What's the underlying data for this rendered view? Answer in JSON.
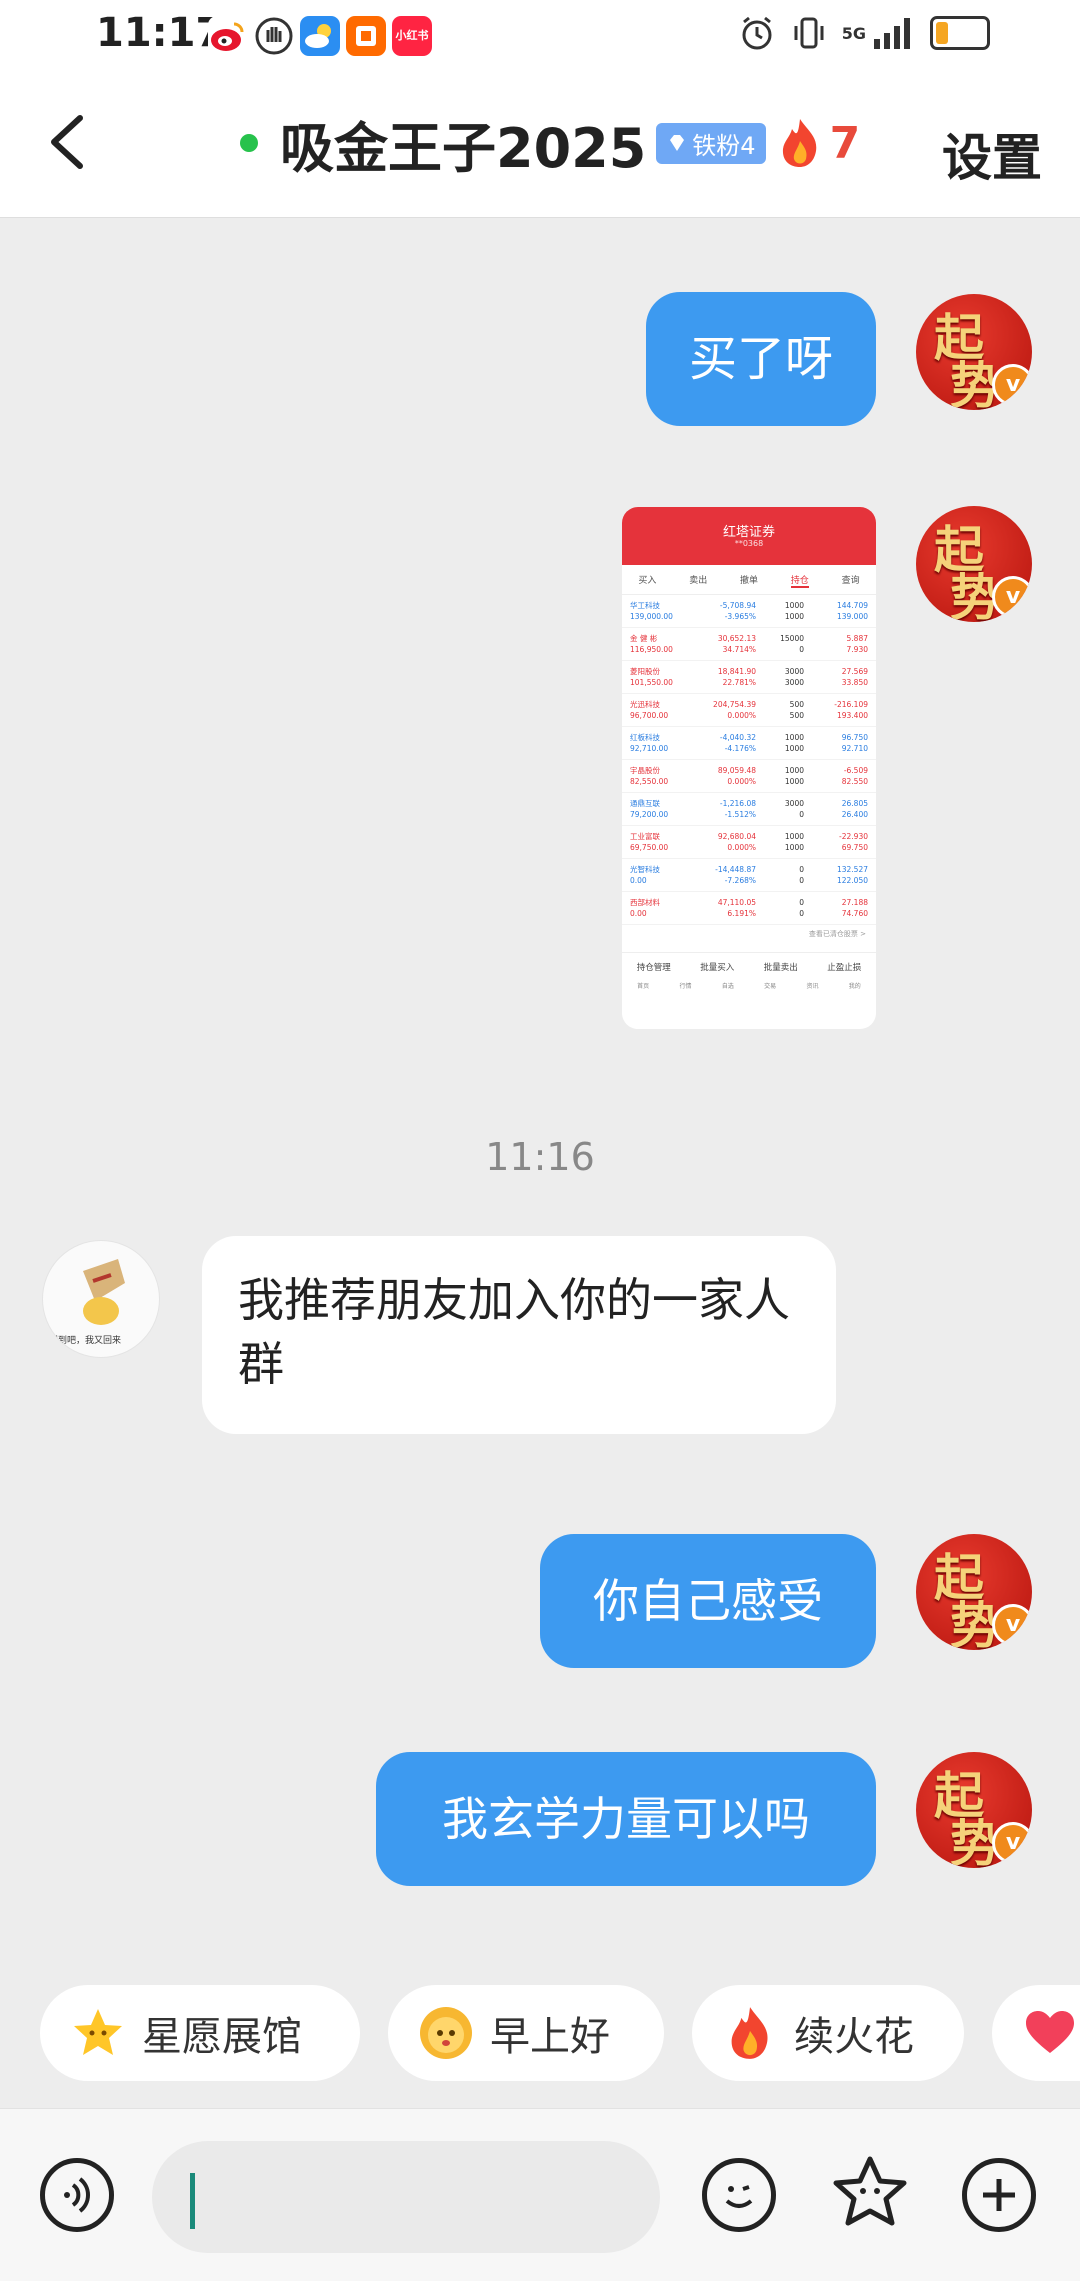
{
  "status_bar": {
    "time": "11:17",
    "app_icons": [
      "weibo-icon",
      "hand-icon",
      "weather-icon",
      "taobao-icon",
      "xiaohongshu-icon"
    ],
    "xiaohongshu_label": "小红书",
    "network": "5G",
    "battery_level": 0.25
  },
  "header": {
    "title": "吸金王子2025",
    "fan_badge": "铁粉4",
    "flame_count": "7",
    "settings_label": "设置",
    "online_color": "#27c24c"
  },
  "messages": [
    {
      "from": "me",
      "text": "买了呀"
    },
    {
      "from": "me",
      "type": "image"
    },
    {
      "from": "other",
      "text": "我推荐朋友加入你的一家人群"
    },
    {
      "from": "me",
      "text": "你自己感受"
    },
    {
      "from": "me",
      "text": "我玄学力量可以吗"
    }
  ],
  "avatar_me": {
    "chars": [
      "起",
      "势"
    ],
    "badge": "v"
  },
  "avatar_other": {
    "caption": "想到吧，我又回来"
  },
  "timestamp": "11:16",
  "shared_screenshot": {
    "app_title": "红塔证券",
    "account": "**0368",
    "tabs": [
      "买入",
      "卖出",
      "撤单",
      "持仓",
      "查询"
    ],
    "active_tab": "持仓",
    "rows": [
      {
        "name": "华工科技",
        "cost": "139,000.00",
        "pnl": "-5,708.94",
        "pct": "-3.965%",
        "qty": "1000",
        "avail": "1000",
        "price": "144.709",
        "cur": "139.000",
        "dir": "down"
      },
      {
        "name": "金 健 彬",
        "cost": "116,950.00",
        "pnl": "30,652.13",
        "pct": "34.714%",
        "qty": "15000",
        "avail": "0",
        "price": "5.887",
        "cur": "7.930",
        "dir": "up"
      },
      {
        "name": "菱阳股份",
        "cost": "101,550.00",
        "pnl": "18,841.90",
        "pct": "22.781%",
        "qty": "3000",
        "avail": "3000",
        "price": "27.569",
        "cur": "33.850",
        "dir": "up"
      },
      {
        "name": "光迅科技",
        "cost": "96,700.00",
        "pnl": "204,754.39",
        "pct": "0.000%",
        "qty": "500",
        "avail": "500",
        "price": "-216.109",
        "cur": "193.400",
        "dir": "up"
      },
      {
        "name": "红板科技",
        "cost": "92,710.00",
        "pnl": "-4,040.32",
        "pct": "-4.176%",
        "qty": "1000",
        "avail": "1000",
        "price": "96.750",
        "cur": "92.710",
        "dir": "down"
      },
      {
        "name": "宇晶股份",
        "cost": "82,550.00",
        "pnl": "89,059.48",
        "pct": "0.000%",
        "qty": "1000",
        "avail": "1000",
        "price": "-6.509",
        "cur": "82.550",
        "dir": "up"
      },
      {
        "name": "通鼎互联",
        "cost": "79,200.00",
        "pnl": "-1,216.08",
        "pct": "-1.512%",
        "qty": "3000",
        "avail": "0",
        "price": "26.805",
        "cur": "26.400",
        "dir": "down"
      },
      {
        "name": "工业富联",
        "cost": "69,750.00",
        "pnl": "92,680.04",
        "pct": "0.000%",
        "qty": "1000",
        "avail": "1000",
        "price": "-22.930",
        "cur": "69.750",
        "dir": "up"
      },
      {
        "name": "光智科技",
        "cost": "0.00",
        "pnl": "-14,448.87",
        "pct": "-7.268%",
        "qty": "0",
        "avail": "0",
        "price": "132.527",
        "cur": "122.050",
        "dir": "down"
      },
      {
        "name": "西部材料",
        "cost": "0.00",
        "pnl": "47,110.05",
        "pct": "6.191%",
        "qty": "0",
        "avail": "0",
        "price": "27.188",
        "cur": "74.760",
        "dir": "up"
      }
    ],
    "more_link": "查看已清仓股票 >",
    "footer_buttons": [
      "持仓管理",
      "批量买入",
      "批量卖出",
      "止盈止损"
    ],
    "nav": [
      "首页",
      "行情",
      "自选",
      "交易",
      "资讯",
      "我的"
    ]
  },
  "quick_replies": [
    {
      "icon": "star-icon",
      "label": "星愿展馆"
    },
    {
      "icon": "sun-face-icon",
      "label": "早上好"
    },
    {
      "icon": "flame-icon",
      "label": "续火花"
    }
  ],
  "input": {
    "placeholder": ""
  },
  "colors": {
    "my_bubble": "#3d9af0",
    "other_bubble": "#ffffff",
    "accent_red": "#e84a3b"
  }
}
